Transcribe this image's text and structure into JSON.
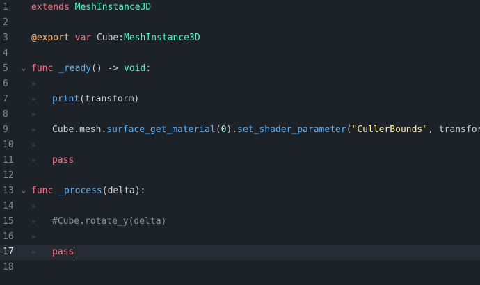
{
  "editor": {
    "indent_marker": "»",
    "lines": [
      {
        "n": "1"
      },
      {
        "n": "2"
      },
      {
        "n": "3"
      },
      {
        "n": "4"
      },
      {
        "n": "5"
      },
      {
        "n": "6"
      },
      {
        "n": "7"
      },
      {
        "n": "8"
      },
      {
        "n": "9"
      },
      {
        "n": "10"
      },
      {
        "n": "11"
      },
      {
        "n": "12"
      },
      {
        "n": "13"
      },
      {
        "n": "14"
      },
      {
        "n": "15"
      },
      {
        "n": "16"
      },
      {
        "n": "17"
      },
      {
        "n": "18"
      }
    ],
    "l1": {
      "kw": "extends",
      "type": "MeshInstance3D"
    },
    "l3": {
      "anno": "@export",
      "kw": "var",
      "name": "Cube",
      "colon": ":",
      "type": "MeshInstance3D"
    },
    "l5": {
      "kw": "func",
      "fn": "_ready",
      "rest": "() -> ",
      "type": "void",
      "end": ":"
    },
    "l7": {
      "fn": "print",
      "rest": "(transform)"
    },
    "l9": {
      "p1": "Cube.mesh.",
      "fn1": "surface_get_material",
      "p2": "(",
      "num": "0",
      "p3": ").",
      "fn2": "set_shader_parameter",
      "p4": "(",
      "str": "\"CullerBounds\"",
      "p5": ", transform)"
    },
    "l11": {
      "kw": "pass"
    },
    "l13": {
      "kw": "func",
      "fn": "_process",
      "rest": "(delta):"
    },
    "l15": {
      "comment": "#Cube.rotate_y(delta)"
    },
    "l17": {
      "kw": "pass"
    }
  },
  "colors": {
    "background": "#1d2229",
    "current_line": "#272c34",
    "keyword": "#ff7085",
    "type": "#42ffc2",
    "annotation": "#ffb373",
    "function": "#57b3ff",
    "string": "#ffeda1",
    "number": "#a1ffe0",
    "comment": "#8a929b"
  },
  "icons": {
    "fold": "fold-arrow-icon",
    "indent": "tab-indent-icon"
  }
}
